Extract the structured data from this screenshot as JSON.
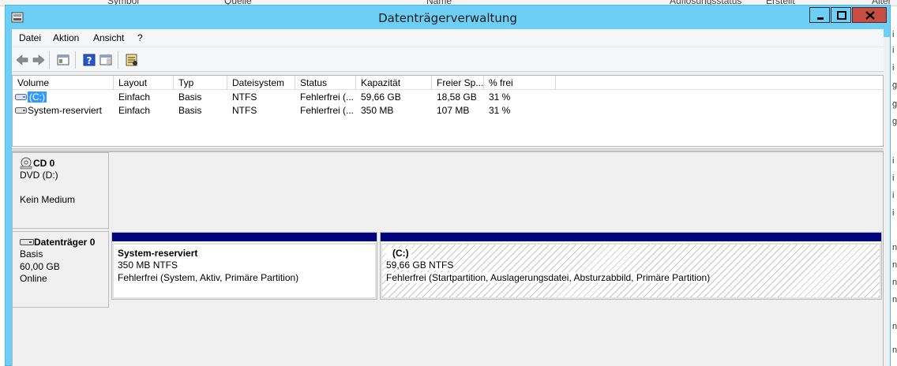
{
  "background": {
    "header_items": [
      "Symbol",
      "Quelle",
      "Name",
      "Auflösungsstatus",
      "Erstellt",
      "Alter"
    ],
    "right_edge_glyphs": [
      "i",
      "i",
      "i",
      "g",
      "g",
      "g",
      "i",
      "i",
      "i",
      "i",
      "n",
      "n",
      "n",
      "n",
      "n",
      "n"
    ]
  },
  "window": {
    "title": "Datenträgerverwaltung",
    "accent": "#6dcff6",
    "close_color": "#c74e43"
  },
  "menu": [
    "Datei",
    "Aktion",
    "Ansicht",
    "?"
  ],
  "toolbar": {
    "buttons": [
      "back-arrow-icon",
      "forward-arrow-icon",
      "console-tree-icon",
      "help-icon",
      "action-pane-icon",
      "properties-icon"
    ]
  },
  "volume_list": {
    "columns": [
      "Volume",
      "Layout",
      "Typ",
      "Dateisystem",
      "Status",
      "Kapazität",
      "Freier Sp...",
      "% frei"
    ],
    "rows": [
      {
        "volume": "(C:)",
        "layout": "Einfach",
        "typ": "Basis",
        "dateisystem": "NTFS",
        "status": "Fehlerfrei (...",
        "kapazitaet": "59,66 GB",
        "frei": "18,58 GB",
        "prozent": "31 %",
        "selected": true
      },
      {
        "volume": "System-reserviert",
        "layout": "Einfach",
        "typ": "Basis",
        "dateisystem": "NTFS",
        "status": "Fehlerfrei (...",
        "kapazitaet": "350 MB",
        "frei": "107 MB",
        "prozent": "31 %",
        "selected": false
      }
    ]
  },
  "disks": [
    {
      "name": "CD 0",
      "lines": [
        "DVD (D:)",
        "",
        "Kein Medium"
      ],
      "partitions": []
    },
    {
      "name": "Datenträger 0",
      "lines": [
        "Basis",
        "60,00 GB",
        "Online"
      ],
      "partitions": [
        {
          "name": "System-reserviert",
          "size": "350 MB NTFS",
          "status": "Fehlerfrei (System, Aktiv, Primäre Partition)",
          "bar_color": "#02047e"
        },
        {
          "name": "(C:)",
          "size": "59,66 GB NTFS",
          "status": "Fehlerfrei (Startpartition, Auslagerungsdatei, Absturzabbild, Primäre Partition)",
          "bar_color": "#02047e"
        }
      ]
    }
  ]
}
